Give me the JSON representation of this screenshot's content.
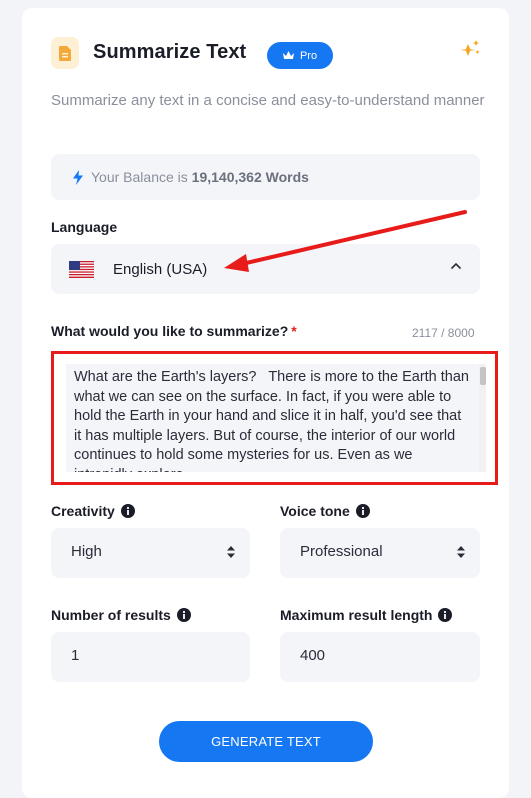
{
  "header": {
    "title": "Summarize Text",
    "badge_label": "Pro",
    "description": "Summarize any text in a concise and easy-to-understand manner"
  },
  "balance": {
    "prefix": "Your Balance is ",
    "amount": "19,140,362 Words"
  },
  "language": {
    "label": "Language",
    "selected": "English (USA)",
    "flag": "us-flag-icon"
  },
  "input": {
    "label": "What would you like to summarize?",
    "required_marker": "*",
    "counter": "2117 / 8000",
    "text": "What are the Earth's layers?   There is more to the Earth than what we can see on the surface. In fact, if you were able to hold the Earth in your hand and slice it in half, you'd see that it has multiple layers. But of course, the interior of our world continues to hold some mysteries for us. Even as we intrepidly explore"
  },
  "creativity": {
    "label": "Creativity",
    "value": "High"
  },
  "voice_tone": {
    "label": "Voice tone",
    "value": "Professional"
  },
  "num_results": {
    "label": "Number of results",
    "value": "1"
  },
  "max_length": {
    "label": "Maximum result length",
    "value": "400"
  },
  "generate_button": "GENERATE TEXT",
  "colors": {
    "accent": "#1677f2",
    "annotation_red": "#e81b1b",
    "field_bg": "#f3f5f9"
  }
}
